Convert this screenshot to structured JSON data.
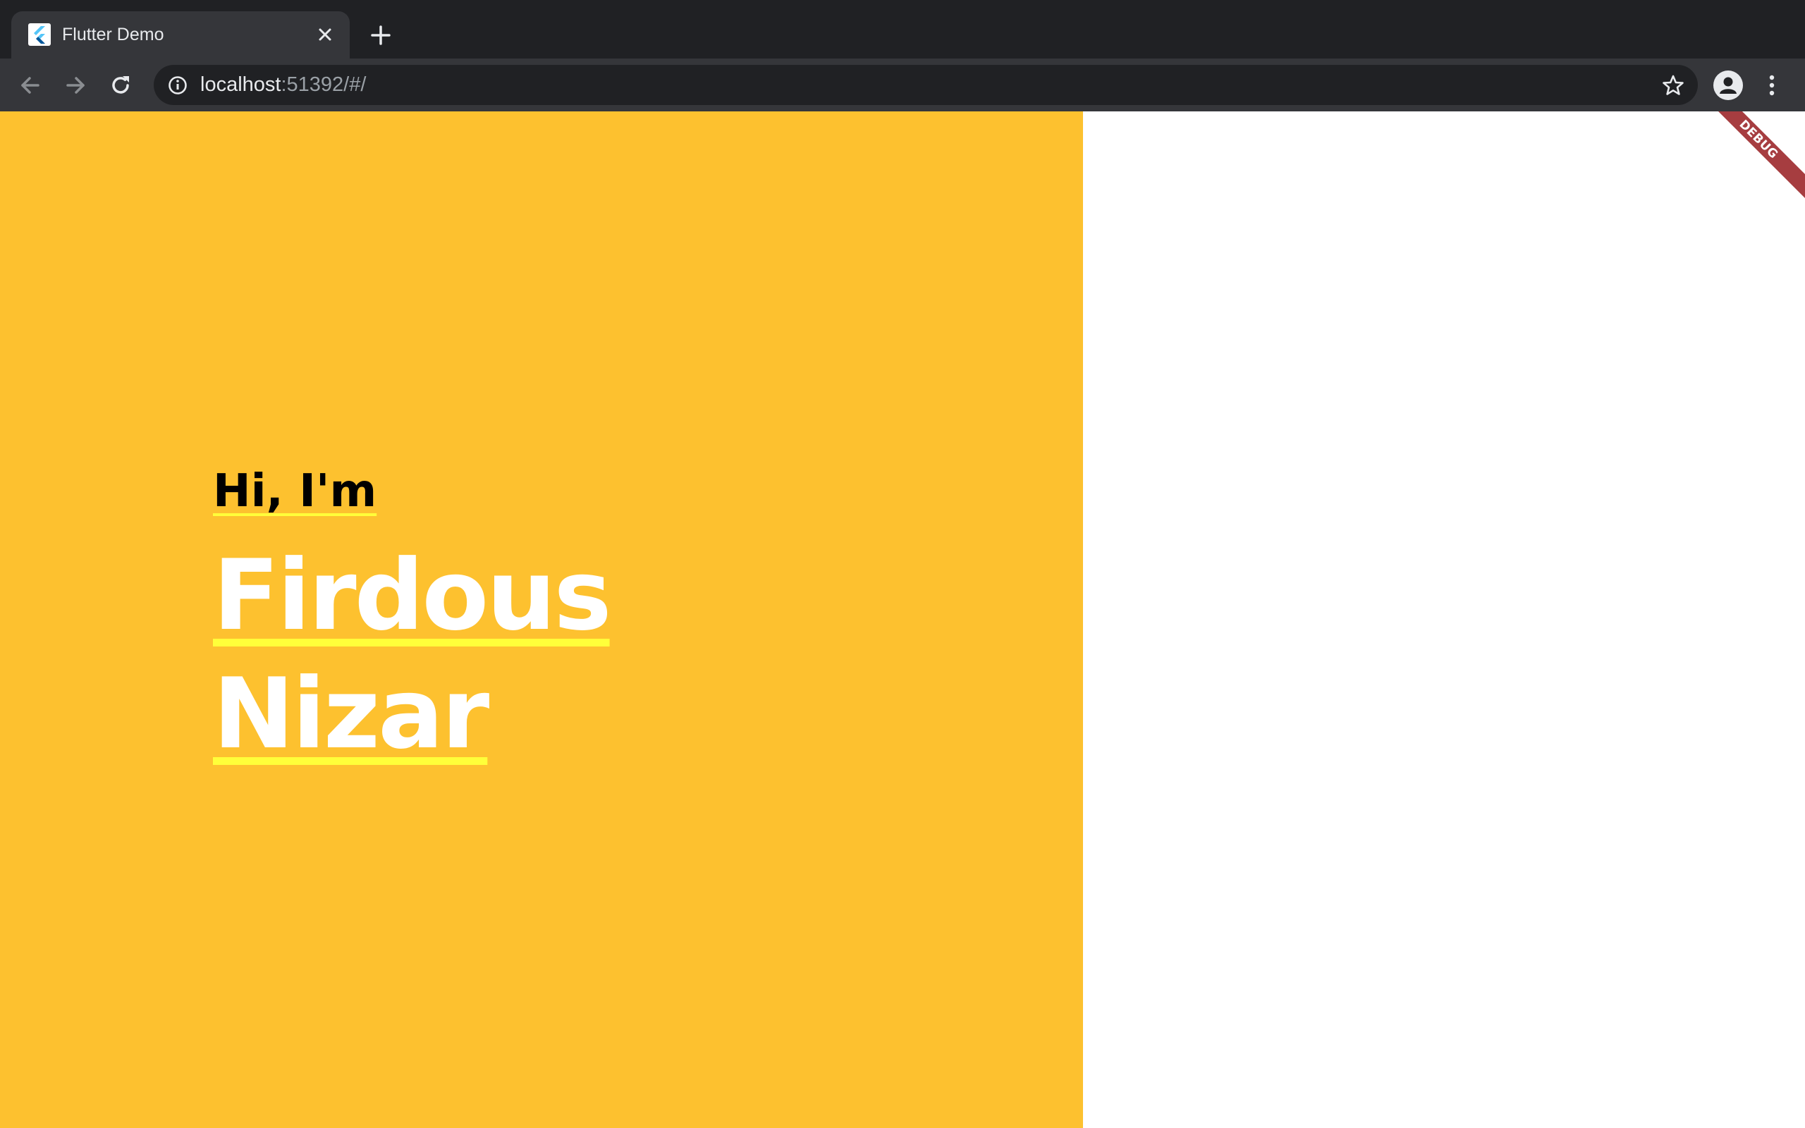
{
  "browser": {
    "tab": {
      "title": "Flutter Demo",
      "favicon": "flutter-logo"
    },
    "address_bar": {
      "host": "localhost",
      "path": ":51392/#/"
    },
    "icons": {
      "back": "arrow-left-icon",
      "forward": "arrow-right-icon",
      "reload": "reload-icon",
      "info": "info-icon",
      "bookmark": "star-icon",
      "profile": "person-icon",
      "menu": "three-dots-vertical-icon",
      "close": "close-icon",
      "new_tab": "plus-icon"
    },
    "colors": {
      "tabstrip": "#202124",
      "toolbar": "#35363a"
    }
  },
  "page": {
    "greeting": "Hi, I'm",
    "name_first": "Firdous",
    "name_last": "Nizar",
    "debug_banner": "DEBUG",
    "colors": {
      "panel": "#fdc12f",
      "underline": "#ffff3a",
      "name_text": "#ffffff",
      "greeting_text": "#000000",
      "debug_banner": "#a63d40"
    }
  }
}
